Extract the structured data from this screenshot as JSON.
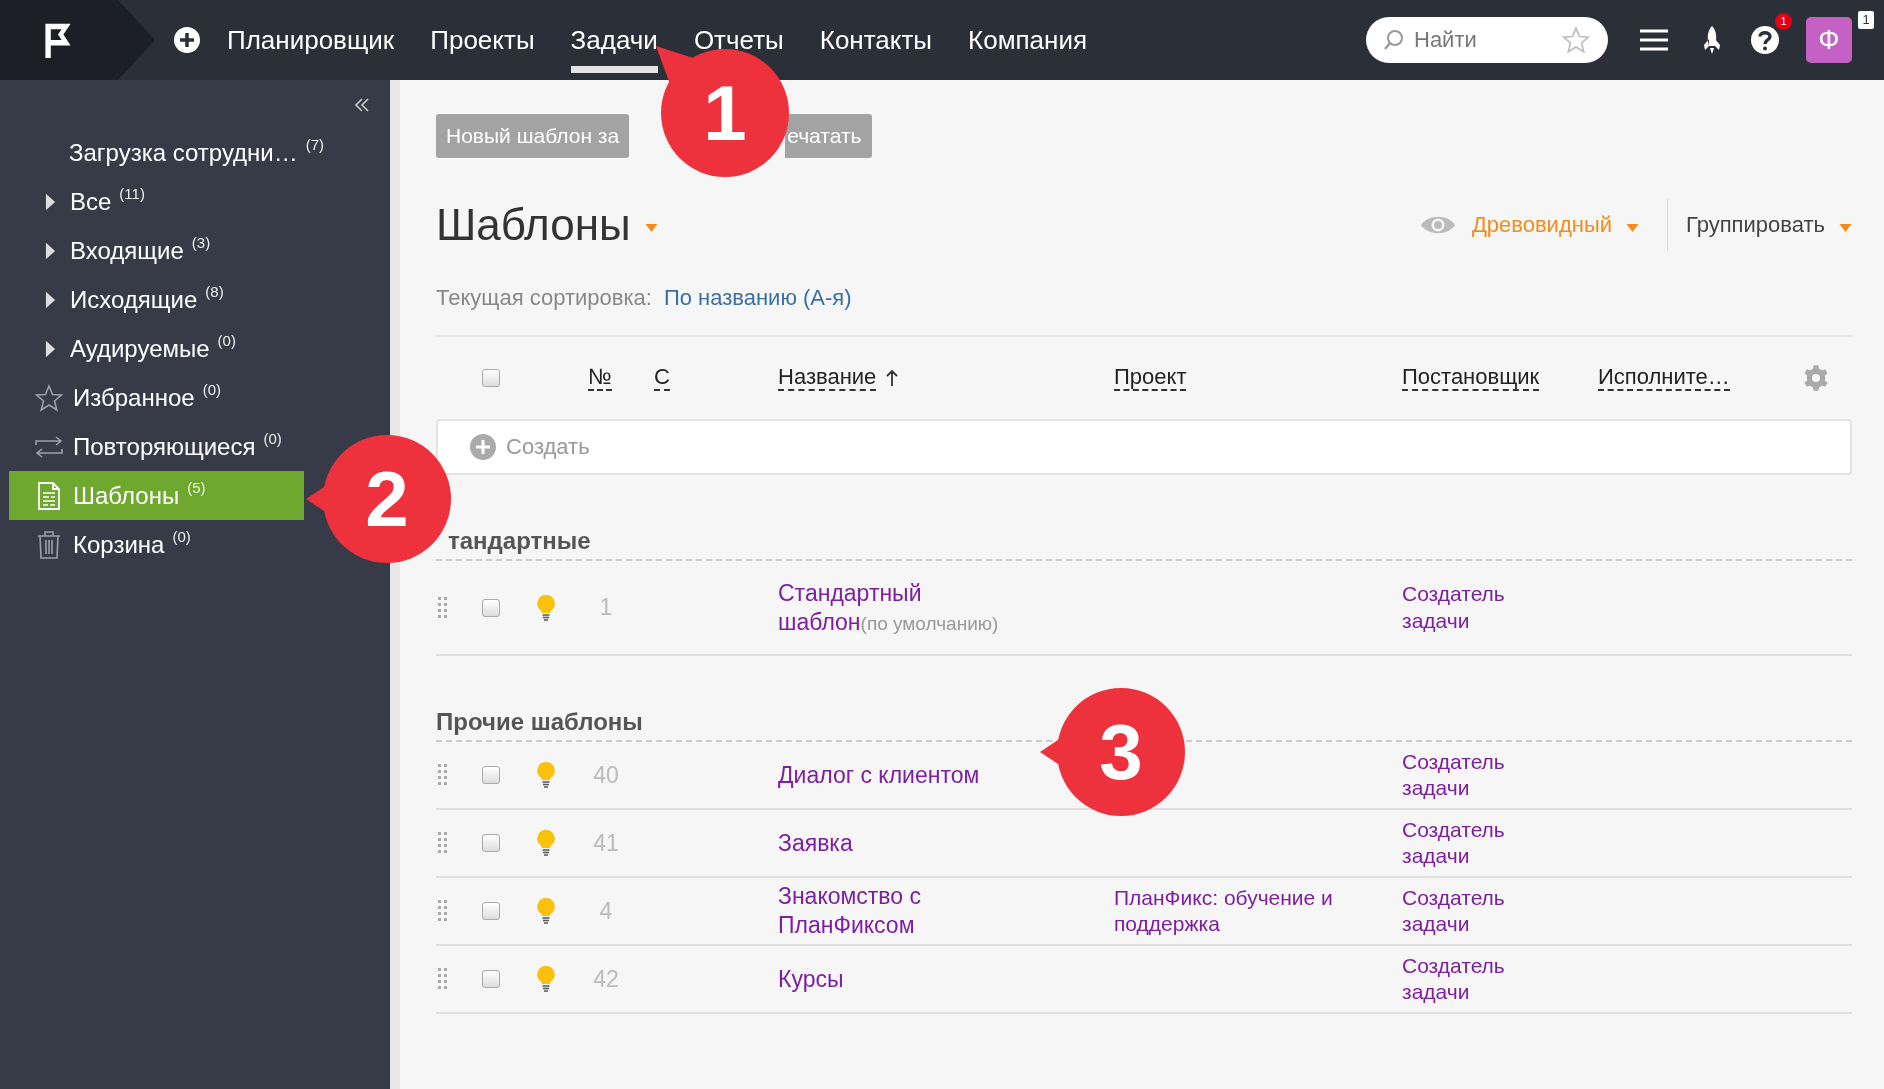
{
  "topbar": {
    "nav": [
      {
        "label": "Планировщик",
        "selected": false
      },
      {
        "label": "Проекты",
        "selected": false
      },
      {
        "label": "Задачи",
        "selected": true
      },
      {
        "label": "Отчеты",
        "selected": false
      },
      {
        "label": "Контакты",
        "selected": false
      },
      {
        "label": "Компания",
        "selected": false
      }
    ],
    "search": {
      "placeholder": "Найти"
    },
    "help_badge": "1",
    "avatar": "Ф",
    "avatar_badge": "1"
  },
  "sidebar": {
    "items": [
      {
        "kind": "plain",
        "label": "Загрузка сотрудни…",
        "count": "(7)",
        "selected": false
      },
      {
        "kind": "expandable",
        "expanded": false,
        "label": "Все",
        "count": "(11)",
        "selected": false
      },
      {
        "kind": "expandable",
        "expanded": false,
        "label": "Входящие",
        "count": "(3)",
        "selected": false
      },
      {
        "kind": "expandable",
        "expanded": false,
        "label": "Исходящие",
        "count": "(8)",
        "selected": false
      },
      {
        "kind": "expandable",
        "expanded": false,
        "label": "Аудируемые",
        "count": "(0)",
        "selected": false
      },
      {
        "kind": "star",
        "label": "Избранное",
        "count": "(0)",
        "selected": false
      },
      {
        "kind": "repeat",
        "label": "Повторяющиеся",
        "count": "(0)",
        "selected": false
      },
      {
        "kind": "template",
        "label": "Шаблоны",
        "count": "(5)",
        "selected": true
      },
      {
        "kind": "trash",
        "label": "Корзина",
        "count": "(0)",
        "selected": false
      }
    ]
  },
  "toolbar": {
    "buttons": [
      "Новый шаблон за",
      "ечатать"
    ]
  },
  "heading": "Шаблоны",
  "view": "Древовидный",
  "group_by": "Группировать",
  "sort": {
    "label": "Текущая сортировка:",
    "value": "По названию (А-я)"
  },
  "table": {
    "select_all": {
      "checked": false
    },
    "columns": [
      {
        "label": "№",
        "sorted": false
      },
      {
        "label": "С",
        "sorted": false
      },
      {
        "label": "Название",
        "sorted": true
      },
      {
        "label": "Проект",
        "sorted": false
      },
      {
        "label": "Постановщик",
        "sorted": false
      },
      {
        "label": "Исполните…",
        "sorted": false
      }
    ],
    "create_placeholder": "Создать",
    "groups": [
      {
        "title": "тандартные",
        "rows": [
          {
            "checked": false,
            "number": "1",
            "name": "Стандартный шаблон",
            "note": "(по умолчанию)",
            "author": "Создатель задачи"
          }
        ]
      },
      {
        "title": "Прочие шаблоны",
        "rows": [
          {
            "checked": false,
            "number": "40",
            "name": "Диалог с клиентом",
            "author": "Создатель задачи"
          },
          {
            "checked": false,
            "number": "41",
            "name": "Заявка",
            "author": "Создатель задачи"
          },
          {
            "checked": false,
            "number": "4",
            "name": "Знакомство с ПланФиксом",
            "project": "ПланФикс: обучение и поддержка",
            "author": "Создатель задачи"
          },
          {
            "checked": false,
            "number": "42",
            "name": "Курсы",
            "author": "Создатель задачи"
          }
        ]
      }
    ]
  },
  "callouts": [
    {
      "number": "1"
    },
    {
      "number": "2"
    },
    {
      "number": "3"
    }
  ]
}
